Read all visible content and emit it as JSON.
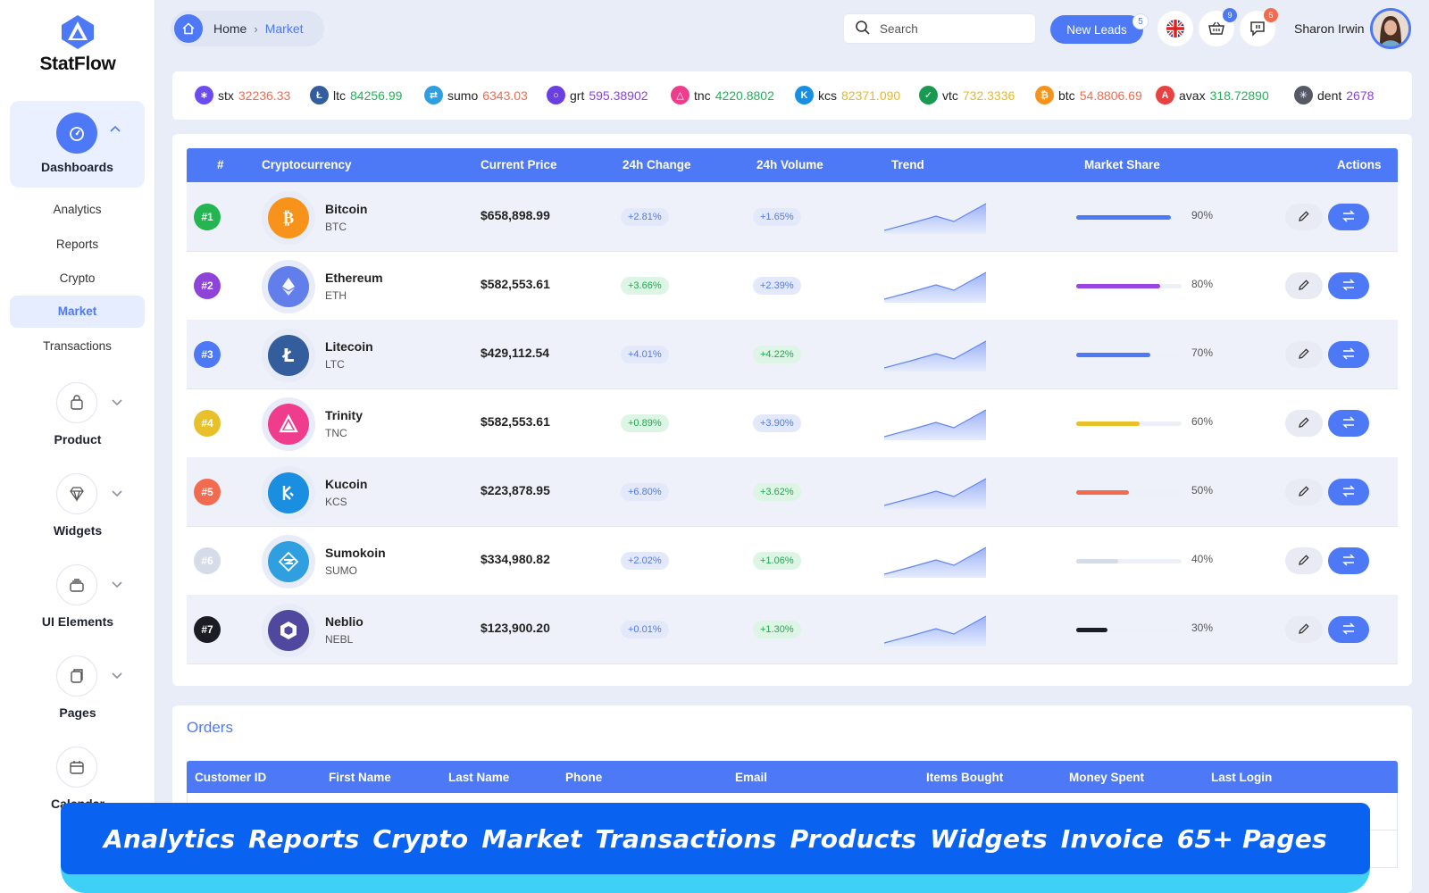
{
  "app": {
    "name": "StatFlow"
  },
  "sidebar": {
    "dashboards": {
      "label": "Dashboards",
      "items": [
        {
          "label": "Analytics",
          "active": false
        },
        {
          "label": "Reports",
          "active": false
        },
        {
          "label": "Crypto",
          "active": false
        },
        {
          "label": "Market",
          "active": true
        },
        {
          "label": "Transactions",
          "active": false
        }
      ]
    },
    "groups": [
      {
        "label": "Product",
        "icon": "bag-icon"
      },
      {
        "label": "Widgets",
        "icon": "diamond-icon"
      },
      {
        "label": "UI Elements",
        "icon": "layers-icon"
      },
      {
        "label": "Pages",
        "icon": "pages-icon"
      },
      {
        "label": "Calendar",
        "icon": "calendar-icon"
      }
    ]
  },
  "topbar": {
    "breadcrumb": {
      "home": "Home",
      "current": "Market"
    },
    "search_placeholder": "Search",
    "new_leads": {
      "label": "New Leads",
      "count": "5"
    },
    "cart_count": "9",
    "messages_count": "5",
    "user_name": "Sharon Irwin"
  },
  "ticker": [
    {
      "sym": "stx",
      "value": "32236.33",
      "color": "#f26b4f",
      "icon_color": "#6a4cf0"
    },
    {
      "sym": "ltc",
      "value": "84256.99",
      "color": "#1fb358",
      "icon_color": "#345d9d"
    },
    {
      "sym": "sumo",
      "value": "6343.03",
      "color": "#f26b4f",
      "icon_color": "#2f9fe0"
    },
    {
      "sym": "grt",
      "value": "595.38902",
      "color": "#8b3fe0",
      "icon_color": "#6a3fe0"
    },
    {
      "sym": "tnc",
      "value": "4220.8802",
      "color": "#1fb358",
      "icon_color": "#f03c8c"
    },
    {
      "sym": "kcs",
      "value": "82371.090",
      "color": "#e8b923",
      "icon_color": "#1a8ee0"
    },
    {
      "sym": "vtc",
      "value": "732.3336",
      "color": "#e8b923",
      "icon_color": "#1a9a50"
    },
    {
      "sym": "btc",
      "value": "54.8806.69",
      "color": "#f26b4f",
      "icon_color": "#f7931a"
    },
    {
      "sym": "avax",
      "value": "318.72890",
      "color": "#1fb358",
      "icon_color": "#e84142"
    },
    {
      "sym": "dent",
      "value": "2678",
      "color": "#8b3fe0",
      "icon_color": "#555a66"
    }
  ],
  "market_table": {
    "columns": [
      "#",
      "Cryptocurrency",
      "Current Price",
      "24h Change",
      "24h Volume",
      "Trend",
      "Market Share",
      "Actions"
    ],
    "rows": [
      {
        "rank": "#1",
        "rank_color": "#22b550",
        "name": "Bitcoin",
        "symbol": "BTC",
        "coin_color": "#f7931a",
        "coin_icon": "bitcoin-icon",
        "price": "$658,898.99",
        "change": "+2.81%",
        "change_style": "blue",
        "volume": "+1.65%",
        "volume_style": "blue",
        "share": 90,
        "share_label": "90%",
        "share_color": "#4d79f6"
      },
      {
        "rank": "#2",
        "rank_color": "#8e44d8",
        "name": "Ethereum",
        "symbol": "ETH",
        "coin_color": "#627eea",
        "coin_icon": "ethereum-icon",
        "price": "$582,553.61",
        "change": "+3.66%",
        "change_style": "green",
        "volume": "+2.39%",
        "volume_style": "blue",
        "share": 80,
        "share_label": "80%",
        "share_color": "#9b44e0"
      },
      {
        "rank": "#3",
        "rank_color": "#4d79f6",
        "name": "Litecoin",
        "symbol": "LTC",
        "coin_color": "#345d9d",
        "coin_icon": "litecoin-icon",
        "price": "$429,112.54",
        "change": "+4.01%",
        "change_style": "blue",
        "volume": "+4.22%",
        "volume_style": "green",
        "share": 70,
        "share_label": "70%",
        "share_color": "#4d79f6"
      },
      {
        "rank": "#4",
        "rank_color": "#e8c12a",
        "name": "Trinity",
        "symbol": "TNC",
        "coin_color": "#f03c8c",
        "coin_icon": "trinity-icon",
        "price": "$582,553.61",
        "change": "+0.89%",
        "change_style": "green",
        "volume": "+3.90%",
        "volume_style": "blue",
        "share": 60,
        "share_label": "60%",
        "share_color": "#e8c12a"
      },
      {
        "rank": "#5",
        "rank_color": "#f26b4f",
        "name": "Kucoin",
        "symbol": "KCS",
        "coin_color": "#1a8ee0",
        "coin_icon": "kucoin-icon",
        "price": "$223,878.95",
        "change": "+6.80%",
        "change_style": "blue",
        "volume": "+3.62%",
        "volume_style": "green",
        "share": 50,
        "share_label": "50%",
        "share_color": "#f26b4f"
      },
      {
        "rank": "#6",
        "rank_color": "#d6dbe8",
        "name": "Sumokoin",
        "symbol": "SUMO",
        "coin_color": "#2f9fe0",
        "coin_icon": "sumokoin-icon",
        "price": "$334,980.82",
        "change": "+2.02%",
        "change_style": "blue",
        "volume": "+1.06%",
        "volume_style": "green",
        "share": 40,
        "share_label": "40%",
        "share_color": "#d6dbe8"
      },
      {
        "rank": "#7",
        "rank_color": "#1b1d24",
        "name": "Neblio",
        "symbol": "NEBL",
        "coin_color": "#50479e",
        "coin_icon": "neblio-icon",
        "price": "$123,900.20",
        "change": "+0.01%",
        "change_style": "blue",
        "volume": "+1.30%",
        "volume_style": "green",
        "share": 30,
        "share_label": "30%",
        "share_color": "#1b1d24"
      }
    ]
  },
  "orders": {
    "title": "Orders",
    "columns": [
      "Customer ID",
      "First Name",
      "Last Name",
      "Phone",
      "Email",
      "Items Bought",
      "Money Spent",
      "Last Login"
    ]
  },
  "banner": {
    "items": [
      "Analytics",
      "Reports",
      "Crypto",
      "Market",
      "Transactions",
      "Products",
      "Widgets",
      "Invoice",
      "65+ Pages"
    ]
  },
  "colors": {
    "accent": "#4d79f6",
    "banner": "#0a63f0",
    "banner_base": "#3ed0f5"
  }
}
